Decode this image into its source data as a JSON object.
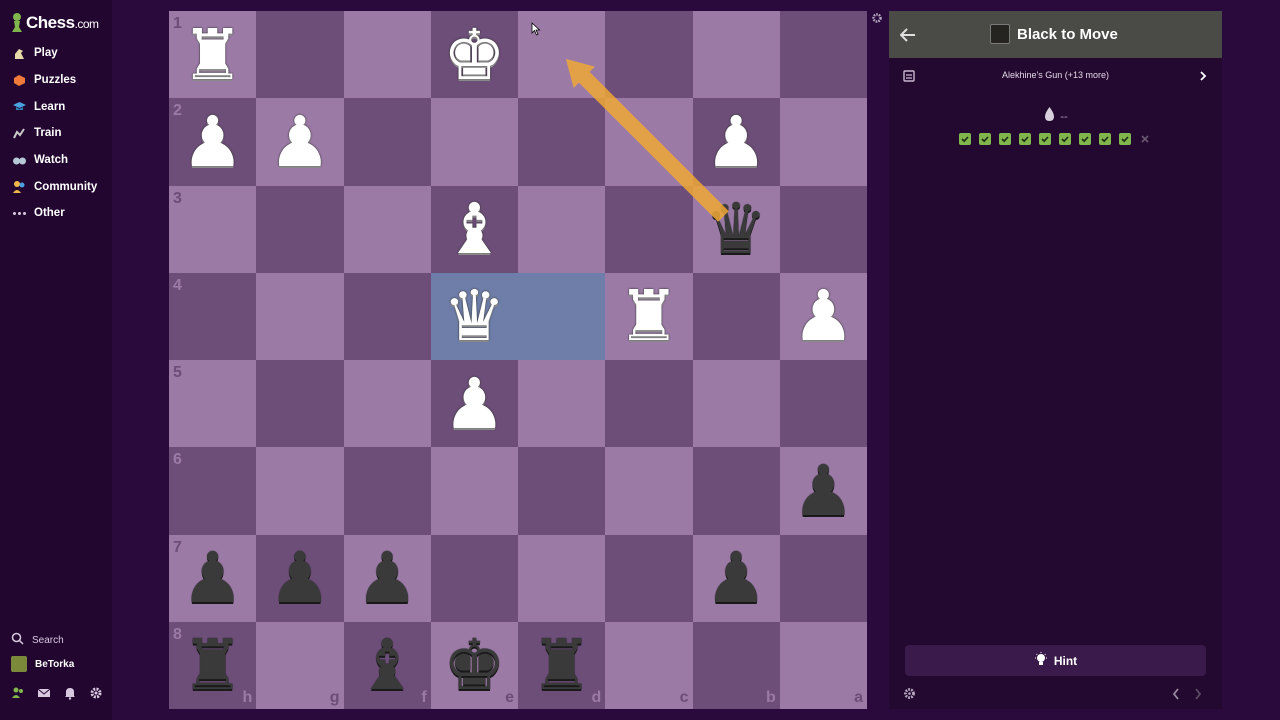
{
  "brand": {
    "name": "Chess",
    "suffix": ".com"
  },
  "nav": [
    {
      "label": "Play",
      "icon": "play-icon"
    },
    {
      "label": "Puzzles",
      "icon": "puzzle-icon"
    },
    {
      "label": "Learn",
      "icon": "learn-icon"
    },
    {
      "label": "Train",
      "icon": "train-icon"
    },
    {
      "label": "Watch",
      "icon": "watch-icon"
    },
    {
      "label": "Community",
      "icon": "community-icon"
    },
    {
      "label": "Other",
      "icon": "more-icon"
    }
  ],
  "sidebar_bottom": {
    "search_label": "Search",
    "username": "BeTorka"
  },
  "board": {
    "orientation": "black",
    "rank_labels": [
      "1",
      "2",
      "3",
      "4",
      "5",
      "6",
      "7",
      "8"
    ],
    "file_labels": [
      "h",
      "g",
      "f",
      "e",
      "d",
      "c",
      "b",
      "a"
    ],
    "pieces": {
      "h1": "wR",
      "e1": "wK",
      "h2": "wP",
      "g2": "wP",
      "b2": "wP",
      "e3": "wB",
      "b3": "bQ",
      "e4": "wQ",
      "c4": "wR",
      "a4": "wP",
      "e5": "wP",
      "a6": "bP",
      "h7": "bP",
      "g7": "bP",
      "f7": "bP",
      "b7": "bP",
      "h8": "bR",
      "f8": "bB",
      "e8": "bK",
      "d8": "bR"
    },
    "highlights": [
      "e4",
      "d4"
    ],
    "arrow": {
      "from": "b3",
      "to": "d1",
      "color": "#f0a836"
    }
  },
  "panel": {
    "title": "Black to Move",
    "theme": "Alekhine's Gun (+13 more)",
    "streak": "--",
    "results": [
      "pass",
      "pass",
      "pass",
      "pass",
      "pass",
      "pass",
      "pass",
      "pass",
      "pass",
      "fail"
    ],
    "hint_label": "Hint"
  },
  "colors": {
    "light_square": "#9b7ba6",
    "dark_square": "#6c4e78",
    "highlight": "#6e7ea8",
    "success": "#81b64c",
    "header": "#4a4a46"
  }
}
